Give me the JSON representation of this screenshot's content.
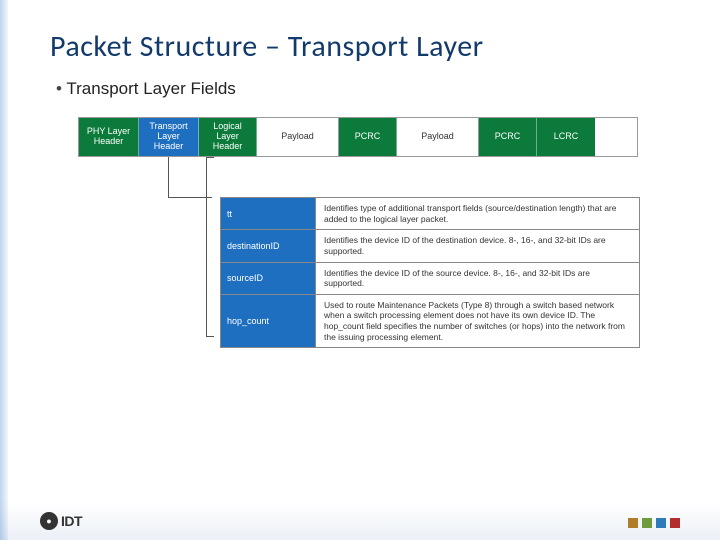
{
  "title": "Packet Structure – Transport Layer",
  "bullet": "Transport Layer Fields",
  "packet": {
    "seg0": "PHY Layer Header",
    "seg1": "Transport Layer Header",
    "seg2": "Logical Layer Header",
    "seg3": "Payload",
    "seg4": "PCRC",
    "seg5": "Payload",
    "seg6": "PCRC",
    "seg7": "LCRC"
  },
  "fields": {
    "r0": {
      "name": "tt",
      "desc": "Identifies type of additional transport fields (source/destination length) that are added to the logical layer packet."
    },
    "r1": {
      "name": "destinationID",
      "desc": "Identifies the device ID of the destination device. 8-, 16-, and 32-bit IDs are supported."
    },
    "r2": {
      "name": "sourceID",
      "desc": "Identifies the device ID of the source device. 8-, 16-, and 32-bit IDs are supported."
    },
    "r3": {
      "name": "hop_count",
      "desc": "Used to route Maintenance Packets (Type 8) through a switch based network when a switch processing element does not have its own device ID. The hop_count field specifies the number of switches (or hops) into the network from the issuing processing element."
    }
  },
  "logo": "IDT",
  "colors": {
    "green": "#0b7a3a",
    "blue": "#1f6fc0",
    "title": "#123a6b"
  }
}
